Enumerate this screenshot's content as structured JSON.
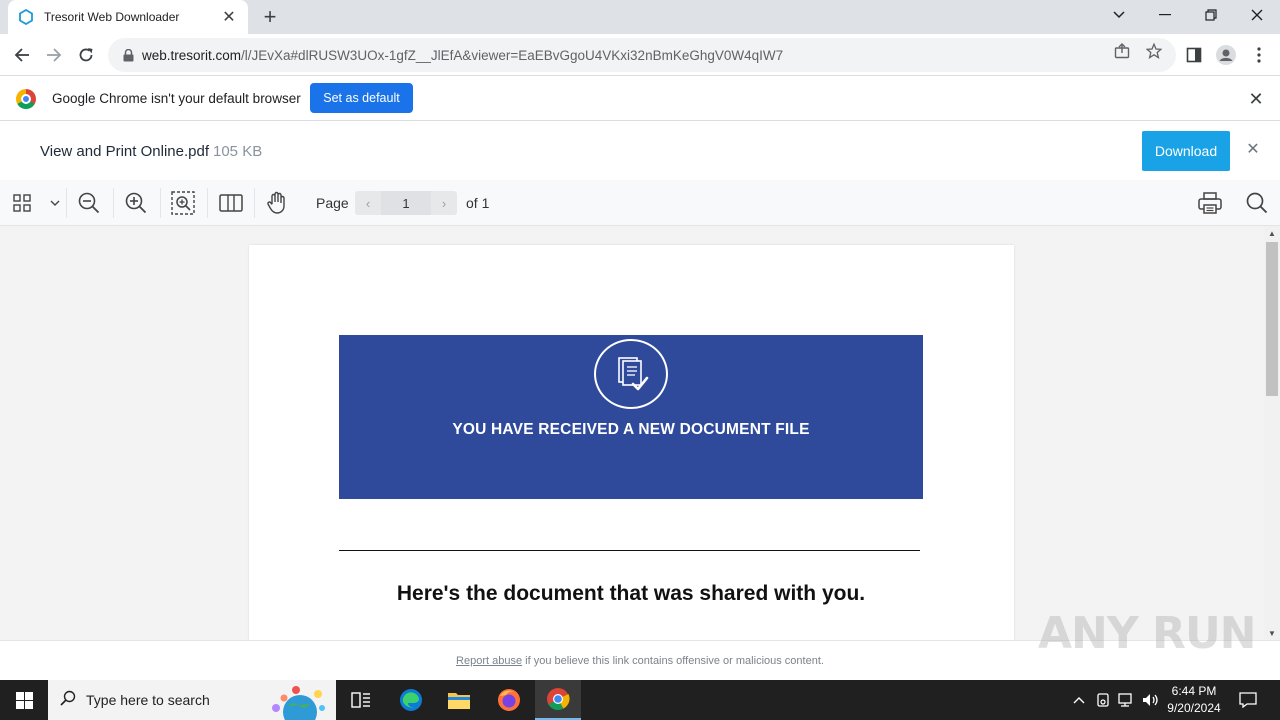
{
  "browser": {
    "tab_title": "Tresorit Web Downloader",
    "url_host": "web.tresorit.com",
    "url_rest": "/l/JEvXa#dlRUSW3UOx-1gfZ__JlEfA&viewer=EaEBvGgoU4VKxi32nBmKeGhgV0W4qIW7",
    "infobar_message": "Google Chrome isn't your default browser",
    "infobar_button": "Set as default"
  },
  "file": {
    "name": "View and Print Online.pdf",
    "size": "105 KB",
    "download_label": "Download"
  },
  "viewer": {
    "page_label": "Page",
    "current_page": "1",
    "of_label": "of 1"
  },
  "document": {
    "banner_text": "YOU HAVE RECEIVED A NEW DOCUMENT FILE",
    "headline": "Here's the document that was shared with you.",
    "banner_color": "#2f4a9b"
  },
  "footer": {
    "report_link": "Report abuse",
    "report_text": " if you believe this link contains offensive or malicious content."
  },
  "watermark": "ANY RUN",
  "taskbar": {
    "search_placeholder": "Type here to search",
    "time": "6:44 PM",
    "date": "9/20/2024"
  },
  "colors": {
    "download_button": "#19a3e6",
    "set_default_button": "#1a73e8"
  }
}
